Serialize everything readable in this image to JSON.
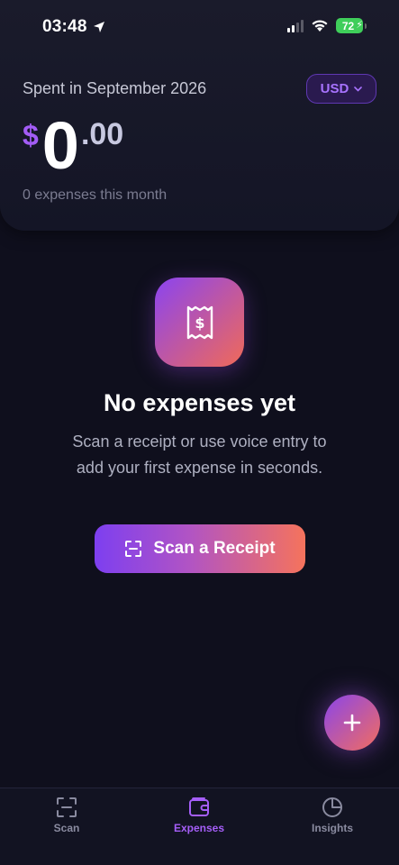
{
  "status_bar": {
    "time": "03:48",
    "battery": "72"
  },
  "header": {
    "spent_label": "Spent in September 2026",
    "currency": "USD",
    "amount_symbol": "$",
    "amount_integer": "0",
    "amount_decimal": ".00",
    "expenses_count": "0 expenses this month"
  },
  "empty_state": {
    "icon": "receipt-dollar-icon",
    "title": "No expenses yet",
    "description": "Scan a receipt or use voice entry to add your first expense in seconds.",
    "button_label": "Scan a Receipt",
    "button_icon": "scan-frame-icon"
  },
  "fab": {
    "icon": "plus-icon"
  },
  "tab_bar": {
    "tabs": [
      {
        "label": "Scan",
        "icon": "scan-icon",
        "active": false
      },
      {
        "label": "Expenses",
        "icon": "wallet-icon",
        "active": true
      },
      {
        "label": "Insights",
        "icon": "pie-chart-icon",
        "active": false
      }
    ]
  },
  "colors": {
    "background": "#0f0f1d",
    "accent_purple": "#a35cf6",
    "accent_coral": "#f06a58",
    "battery_green": "#3fce5a"
  }
}
